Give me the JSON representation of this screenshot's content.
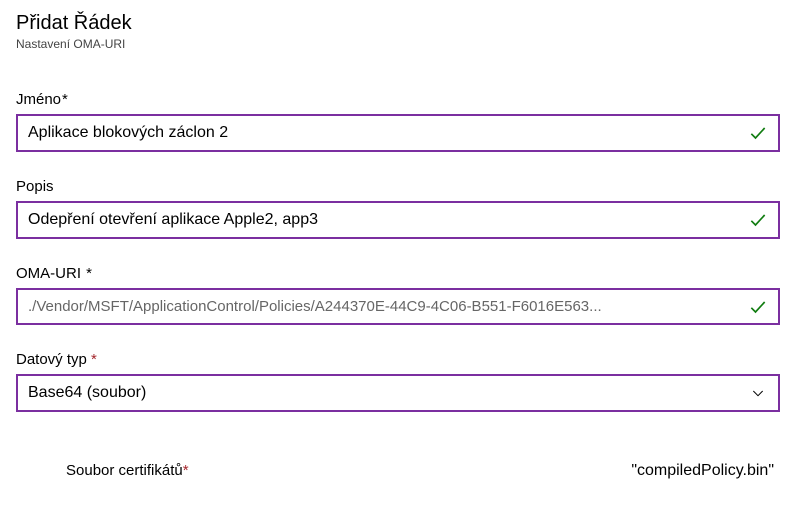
{
  "header": {
    "title": "Přidat Řádek",
    "subtitle": "Nastavení OMA-URI"
  },
  "fields": {
    "name": {
      "label": "Jméno",
      "value": "Aplikace blokových záclon 2"
    },
    "description": {
      "label": "Popis",
      "value": "Odepření otevření aplikace Apple2, app3"
    },
    "omauri": {
      "label": "OMA-URI ",
      "value": "./Vendor/MSFT/ApplicationControl/Policies/A244370E-44C9-4C06-B551-F6016E563..."
    },
    "datatype": {
      "label": "Datový typ",
      "value": "Base64 (soubor)"
    }
  },
  "footer": {
    "cert_label": "Soubor certifikátů",
    "cert_value": "\"compiledPolicy.bin\""
  },
  "colors": {
    "border": "#7b2fa0",
    "success": "#107c10"
  }
}
